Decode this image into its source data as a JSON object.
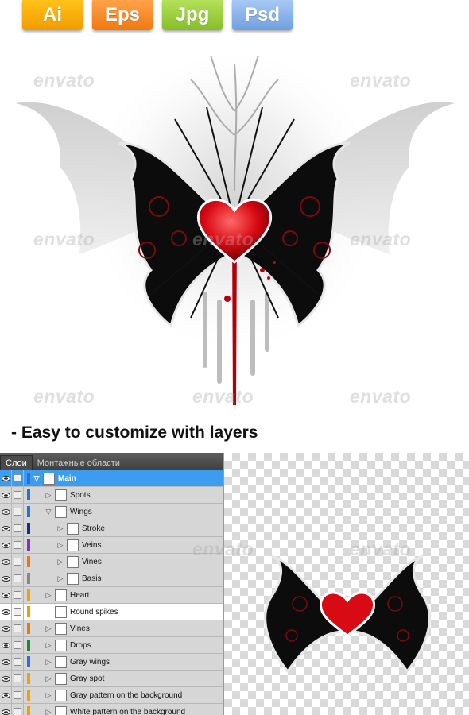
{
  "formats": [
    "Ai",
    "Eps",
    "Jpg",
    "Psd"
  ],
  "watermark": "envato",
  "headline": "- Easy to customize with layers",
  "panel": {
    "tabs": [
      "Слои",
      "Монтажные области"
    ],
    "layers": [
      {
        "name": "Main",
        "color": "#2a6fd6",
        "depth": 0,
        "expanded": true,
        "selected": true
      },
      {
        "name": "Spots",
        "color": "#2a6fd6",
        "depth": 1,
        "expanded": false
      },
      {
        "name": "Wings",
        "color": "#2a6fd6",
        "depth": 1,
        "expanded": true
      },
      {
        "name": "Stroke",
        "color": "#1a2a8a",
        "depth": 2,
        "expanded": false
      },
      {
        "name": "Veins",
        "color": "#8a2ad0",
        "depth": 2,
        "expanded": false
      },
      {
        "name": "Vines",
        "color": "#f07800",
        "depth": 2,
        "expanded": false
      },
      {
        "name": "Basis",
        "color": "#888888",
        "depth": 2,
        "expanded": false
      },
      {
        "name": "Heart",
        "color": "#f0a000",
        "depth": 1,
        "expanded": false
      },
      {
        "name": "Round spikes",
        "color": "#f0a000",
        "depth": 1,
        "expanded": null
      },
      {
        "name": "Vines",
        "color": "#f07800",
        "depth": 1,
        "expanded": false
      },
      {
        "name": "Drops",
        "color": "#1a8a2a",
        "depth": 1,
        "expanded": false
      },
      {
        "name": "Gray wings",
        "color": "#2a6fd6",
        "depth": 1,
        "expanded": false
      },
      {
        "name": "Gray spot",
        "color": "#f0a000",
        "depth": 1,
        "expanded": false
      },
      {
        "name": "Gray pattern on the background",
        "color": "#f0a000",
        "depth": 1,
        "expanded": false
      },
      {
        "name": "White pattern on the background",
        "color": "#f0a000",
        "depth": 1,
        "expanded": false
      }
    ]
  },
  "colors": {
    "heart": "#e0101a",
    "wing": "#0c0c0c",
    "vine": "#7a0a10",
    "grayWing": "#bdbdbd"
  }
}
